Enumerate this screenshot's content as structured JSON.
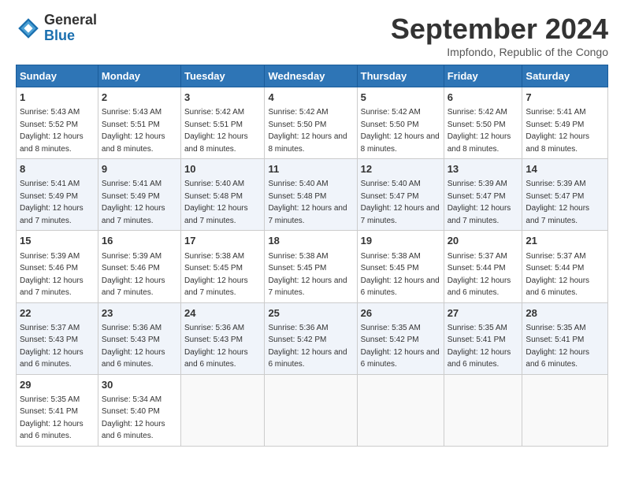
{
  "logo": {
    "general": "General",
    "blue": "Blue"
  },
  "title": "September 2024",
  "subtitle": "Impfondo, Republic of the Congo",
  "days_of_week": [
    "Sunday",
    "Monday",
    "Tuesday",
    "Wednesday",
    "Thursday",
    "Friday",
    "Saturday"
  ],
  "weeks": [
    [
      {
        "day": "1",
        "sunrise": "5:43 AM",
        "sunset": "5:52 PM",
        "daylight": "12 hours and 8 minutes."
      },
      {
        "day": "2",
        "sunrise": "5:43 AM",
        "sunset": "5:51 PM",
        "daylight": "12 hours and 8 minutes."
      },
      {
        "day": "3",
        "sunrise": "5:42 AM",
        "sunset": "5:51 PM",
        "daylight": "12 hours and 8 minutes."
      },
      {
        "day": "4",
        "sunrise": "5:42 AM",
        "sunset": "5:50 PM",
        "daylight": "12 hours and 8 minutes."
      },
      {
        "day": "5",
        "sunrise": "5:42 AM",
        "sunset": "5:50 PM",
        "daylight": "12 hours and 8 minutes."
      },
      {
        "day": "6",
        "sunrise": "5:42 AM",
        "sunset": "5:50 PM",
        "daylight": "12 hours and 8 minutes."
      },
      {
        "day": "7",
        "sunrise": "5:41 AM",
        "sunset": "5:49 PM",
        "daylight": "12 hours and 8 minutes."
      }
    ],
    [
      {
        "day": "8",
        "sunrise": "5:41 AM",
        "sunset": "5:49 PM",
        "daylight": "12 hours and 7 minutes."
      },
      {
        "day": "9",
        "sunrise": "5:41 AM",
        "sunset": "5:49 PM",
        "daylight": "12 hours and 7 minutes."
      },
      {
        "day": "10",
        "sunrise": "5:40 AM",
        "sunset": "5:48 PM",
        "daylight": "12 hours and 7 minutes."
      },
      {
        "day": "11",
        "sunrise": "5:40 AM",
        "sunset": "5:48 PM",
        "daylight": "12 hours and 7 minutes."
      },
      {
        "day": "12",
        "sunrise": "5:40 AM",
        "sunset": "5:47 PM",
        "daylight": "12 hours and 7 minutes."
      },
      {
        "day": "13",
        "sunrise": "5:39 AM",
        "sunset": "5:47 PM",
        "daylight": "12 hours and 7 minutes."
      },
      {
        "day": "14",
        "sunrise": "5:39 AM",
        "sunset": "5:47 PM",
        "daylight": "12 hours and 7 minutes."
      }
    ],
    [
      {
        "day": "15",
        "sunrise": "5:39 AM",
        "sunset": "5:46 PM",
        "daylight": "12 hours and 7 minutes."
      },
      {
        "day": "16",
        "sunrise": "5:39 AM",
        "sunset": "5:46 PM",
        "daylight": "12 hours and 7 minutes."
      },
      {
        "day": "17",
        "sunrise": "5:38 AM",
        "sunset": "5:45 PM",
        "daylight": "12 hours and 7 minutes."
      },
      {
        "day": "18",
        "sunrise": "5:38 AM",
        "sunset": "5:45 PM",
        "daylight": "12 hours and 7 minutes."
      },
      {
        "day": "19",
        "sunrise": "5:38 AM",
        "sunset": "5:45 PM",
        "daylight": "12 hours and 6 minutes."
      },
      {
        "day": "20",
        "sunrise": "5:37 AM",
        "sunset": "5:44 PM",
        "daylight": "12 hours and 6 minutes."
      },
      {
        "day": "21",
        "sunrise": "5:37 AM",
        "sunset": "5:44 PM",
        "daylight": "12 hours and 6 minutes."
      }
    ],
    [
      {
        "day": "22",
        "sunrise": "5:37 AM",
        "sunset": "5:43 PM",
        "daylight": "12 hours and 6 minutes."
      },
      {
        "day": "23",
        "sunrise": "5:36 AM",
        "sunset": "5:43 PM",
        "daylight": "12 hours and 6 minutes."
      },
      {
        "day": "24",
        "sunrise": "5:36 AM",
        "sunset": "5:43 PM",
        "daylight": "12 hours and 6 minutes."
      },
      {
        "day": "25",
        "sunrise": "5:36 AM",
        "sunset": "5:42 PM",
        "daylight": "12 hours and 6 minutes."
      },
      {
        "day": "26",
        "sunrise": "5:35 AM",
        "sunset": "5:42 PM",
        "daylight": "12 hours and 6 minutes."
      },
      {
        "day": "27",
        "sunrise": "5:35 AM",
        "sunset": "5:41 PM",
        "daylight": "12 hours and 6 minutes."
      },
      {
        "day": "28",
        "sunrise": "5:35 AM",
        "sunset": "5:41 PM",
        "daylight": "12 hours and 6 minutes."
      }
    ],
    [
      {
        "day": "29",
        "sunrise": "5:35 AM",
        "sunset": "5:41 PM",
        "daylight": "12 hours and 6 minutes."
      },
      {
        "day": "30",
        "sunrise": "5:34 AM",
        "sunset": "5:40 PM",
        "daylight": "12 hours and 6 minutes."
      },
      null,
      null,
      null,
      null,
      null
    ]
  ]
}
